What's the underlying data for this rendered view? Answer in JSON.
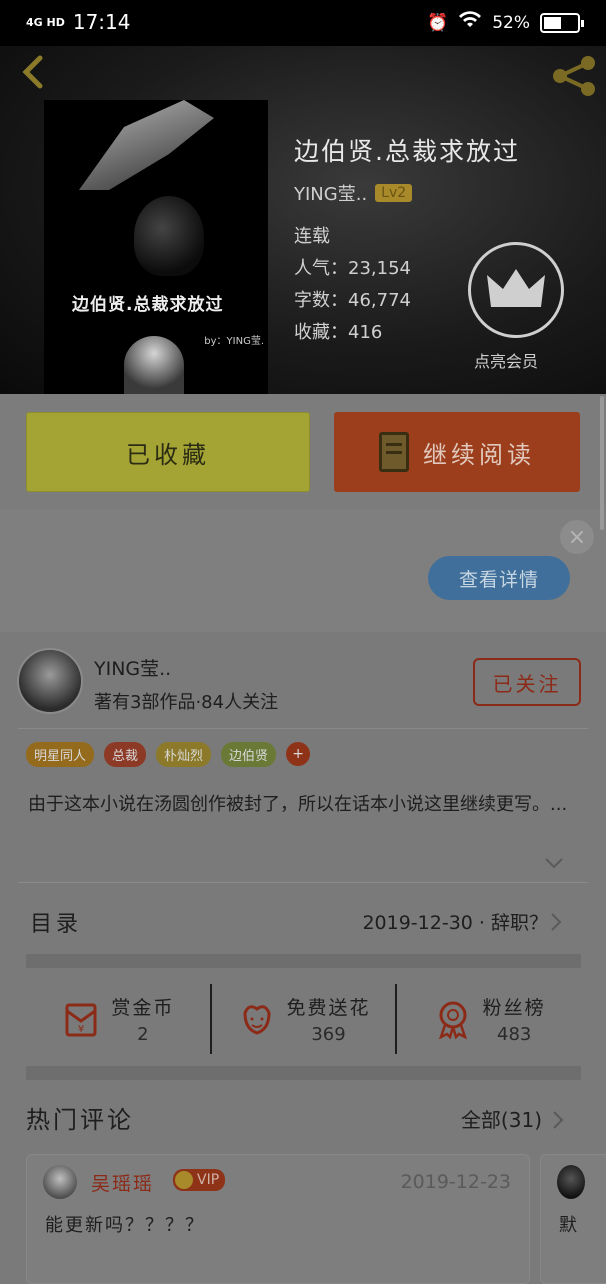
{
  "status": {
    "network": "4G HD",
    "time": "17:14",
    "battery": "52%",
    "battery_level": 0.52
  },
  "book": {
    "title": "边伯贤.总裁求放过",
    "author": "YING莹..",
    "level": "Lv2",
    "status": "连载",
    "popularity": "人气：23,154",
    "words": "字数：46,774",
    "collects": "收藏：416",
    "cover_title": "边伯贤.总裁求放过",
    "cover_by": "by：YING莹.",
    "vip_label": "点亮会员"
  },
  "actions": {
    "collected": "已收藏",
    "continue": "继续阅读"
  },
  "ad": {
    "details": "查看详情",
    "close": "×"
  },
  "author": {
    "name": "YING莹..",
    "stats": "著有3部作品·84人关注",
    "follow": "已关注",
    "tags": [
      {
        "label": "明星同人",
        "color": "#946a1c"
      },
      {
        "label": "总裁",
        "color": "#8c3a26"
      },
      {
        "label": "朴灿烈",
        "color": "#8c7a2a"
      },
      {
        "label": "边伯贤",
        "color": "#6a7a36"
      }
    ],
    "tag_more": "+"
  },
  "intro": "由于这本小说在汤圆创作被封了，所以在话本小说这里继续更写。...",
  "toc": {
    "label": "目录",
    "latest": "2019-12-30 · 辞职？"
  },
  "stats": [
    {
      "label": "赏金币",
      "value": "2",
      "icon": "red-envelope-icon"
    },
    {
      "label": "免费送花",
      "value": "369",
      "icon": "flower-icon"
    },
    {
      "label": "粉丝榜",
      "value": "483",
      "icon": "medal-icon"
    }
  ],
  "comments": {
    "title": "热门评论",
    "all": "全部(31)",
    "items": [
      {
        "user": "吴瑶瑶",
        "badge": "VIP",
        "date": "2019-12-23",
        "text": "能更新吗？？？？"
      },
      {
        "text": "默"
      }
    ]
  },
  "colors": {
    "accent_red": "#8c2a18",
    "collected_yellow": "#a4a435",
    "details_blue": "#3f6f9a"
  }
}
